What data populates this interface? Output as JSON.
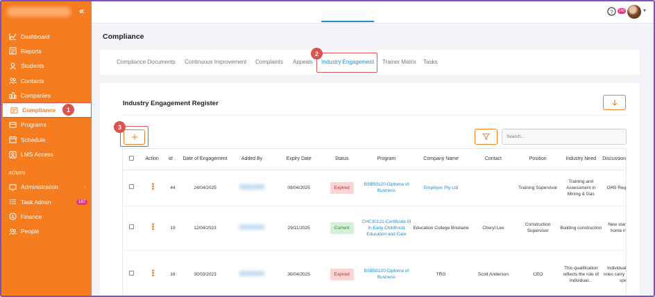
{
  "sidebar": {
    "items": [
      {
        "label": "Dashboard",
        "icon": "chart-line-icon"
      },
      {
        "label": "Reports",
        "icon": "report-icon"
      },
      {
        "label": "Students",
        "icon": "students-icon"
      },
      {
        "label": "Contacts",
        "icon": "contacts-icon"
      },
      {
        "label": "Companies",
        "icon": "companies-icon"
      },
      {
        "label": "Compliance",
        "icon": "compliance-icon"
      },
      {
        "label": "Programs",
        "icon": "programs-icon"
      },
      {
        "label": "Schedule",
        "icon": "calendar-icon"
      },
      {
        "label": "LMS Access",
        "icon": "lms-icon"
      }
    ],
    "admin_label": "ADMIN",
    "admin_items": [
      {
        "label": "Administration",
        "icon": "admin-icon"
      },
      {
        "label": "Task Admin",
        "icon": "task-icon",
        "badge": "167"
      },
      {
        "label": "Finance",
        "icon": "finance-icon"
      },
      {
        "label": "People",
        "icon": "people-icon"
      }
    ],
    "collapse_glyph": "«"
  },
  "topbar": {
    "notif_count": "140"
  },
  "page": {
    "title": "Compliance"
  },
  "tabs": [
    {
      "label": "Compliance Documents"
    },
    {
      "label": "Continuous Improvement"
    },
    {
      "label": "Complaints"
    },
    {
      "label": "Appeals"
    },
    {
      "label": "Industry Engagement"
    },
    {
      "label": "Trainer Matrix"
    },
    {
      "label": "Tasks"
    }
  ],
  "register": {
    "title": "Industry Engagement Register",
    "search_placeholder": "Search..."
  },
  "steps": [
    "1",
    "2",
    "3"
  ],
  "table": {
    "headers": [
      "Action",
      "Id",
      "Date of Engagement",
      "Added By",
      "Expiry Date",
      "Status",
      "Program",
      "Company Name",
      "Contact",
      "Position",
      "Industry Need",
      "Discussion Point"
    ],
    "rows": [
      {
        "id": "44",
        "date": "24/04/2025",
        "expiry": "09/04/2025",
        "status": "Expired",
        "program": "BSB50120-Diploma of Business",
        "company": "Employer Pty Ltd",
        "contact": "",
        "position": "Training Supervisor",
        "need": "Training and Assessment in Mining & Gas",
        "discussion": "OHS Requirements"
      },
      {
        "id": "19",
        "date": "12/04/2023",
        "expiry": "29/11/2025",
        "status": "Current",
        "program": "CHC30121-Certificate III in Early Childhood Education and Care",
        "company": "Education College Brisbane",
        "contact": "Cheryl Lee",
        "position": "Construction Supervisor",
        "need": "Building construction",
        "discussion": "New standards for home insulation"
      },
      {
        "id": "16",
        "date": "30/03/2023",
        "expiry": "30/04/2025",
        "status": "Expired",
        "program": "BSB50120-Diploma of Business",
        "company": "TRG",
        "contact": "Scott Anderson",
        "position": "CEO",
        "need": "This qualification reflects the role of individual...",
        "discussion": "Individuals in these roles carry out a mix of spec..."
      }
    ]
  },
  "colors": {
    "brand": "#f57c1f",
    "link": "#1a8ccf",
    "highlight": "#d9534f"
  }
}
